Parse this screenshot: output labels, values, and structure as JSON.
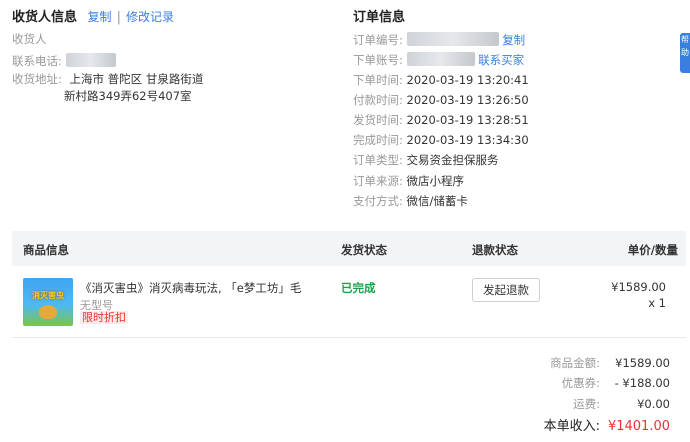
{
  "receiver": {
    "title": "收货人信息",
    "copy_link": "复制",
    "separator": "|",
    "history_link": "修改记录",
    "fields": [
      {
        "label": "收货人",
        "value": ""
      },
      {
        "label": "联系电话:",
        "value": ""
      },
      {
        "label": "收货地址:",
        "value": "上海市 普陀区 甘泉路街道",
        "value2": "新村路349弄62号407室"
      }
    ]
  },
  "order": {
    "title": "订单信息",
    "order_no_label": "订单编号:",
    "order_no_suffix": "复制",
    "account_label": "下单账号:",
    "account_suffix": "联系买家",
    "fields": [
      {
        "label": "下单时间:",
        "value": "2020-03-19 13:20:41"
      },
      {
        "label": "付款时间:",
        "value": "2020-03-19 13:26:50"
      },
      {
        "label": "发货时间:",
        "value": "2020-03-19 13:28:51"
      },
      {
        "label": "完成时间:",
        "value": "2020-03-19 13:34:30"
      },
      {
        "label": "订单类型:",
        "value": "交易资金担保服务"
      },
      {
        "label": "订单来源:",
        "value": "微店小程序"
      },
      {
        "label": "支付方式:",
        "value": "微信/储蓄卡"
      }
    ]
  },
  "float_button": {
    "label": "帮助"
  },
  "table": {
    "headers": {
      "product": "商品信息",
      "shipping": "发货状态",
      "refund": "退款状态",
      "price": "单价/数量"
    },
    "product": {
      "thumb_text": "消灭害虫",
      "name": "《消灭害虫》消灭病毒玩法, 「e梦工坊」毛",
      "model": "无型号",
      "tag": "限时折扣",
      "shipping_status": "已完成",
      "refund_button": "发起退款",
      "price": "¥1589.00",
      "quantity": "x 1"
    }
  },
  "summary": {
    "rows": [
      {
        "label": "商品金额:",
        "value": "¥1589.00"
      },
      {
        "label": "优惠券:",
        "value": "- ¥188.00"
      },
      {
        "label": "运费:",
        "value": "¥0.00"
      }
    ],
    "total_label": "本单收入:",
    "total_value": "¥1401.00"
  },
  "colors": {
    "link": "#3a7ee0",
    "success": "#1aa34a",
    "danger": "#e93232"
  }
}
